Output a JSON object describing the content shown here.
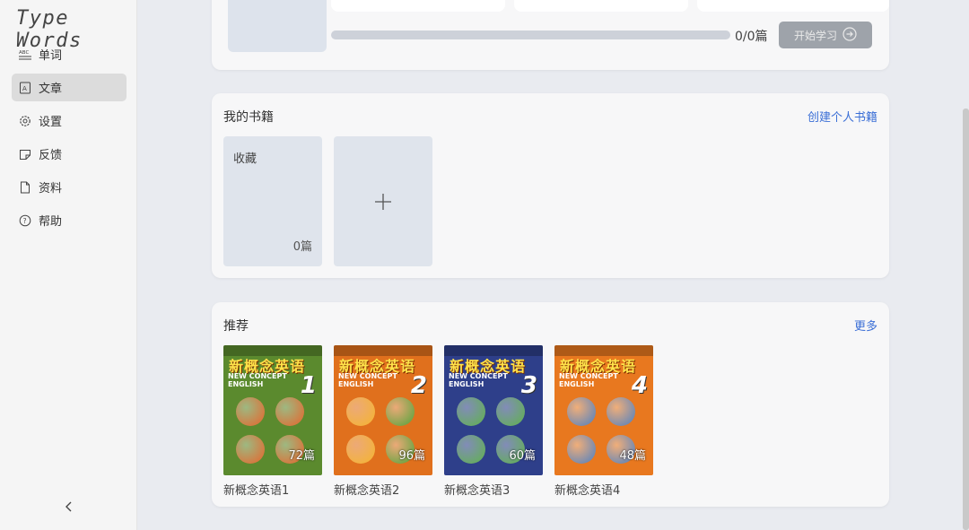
{
  "app": {
    "logo": "Type Words"
  },
  "sidebar": {
    "items": [
      {
        "label": "单词",
        "icon": "abc-icon",
        "active": false
      },
      {
        "label": "文章",
        "icon": "article-icon",
        "active": true
      },
      {
        "label": "设置",
        "icon": "gear-icon",
        "active": false
      },
      {
        "label": "反馈",
        "icon": "feedback-icon",
        "active": false
      },
      {
        "label": "资料",
        "icon": "file-icon",
        "active": false
      },
      {
        "label": "帮助",
        "icon": "help-icon",
        "active": false
      }
    ],
    "collapse_icon": "chevron-left-icon"
  },
  "current": {
    "progress_text": "0/0篇",
    "progress": 0,
    "start_button": "开始学习"
  },
  "my_books": {
    "title": "我的书籍",
    "create_link": "创建个人书籍",
    "favorites": {
      "title": "收藏",
      "count": "0篇"
    },
    "add_icon": "plus-icon"
  },
  "recommend": {
    "title": "推荐",
    "more_link": "更多",
    "books": [
      {
        "name": "新概念英语1",
        "count": "72篇",
        "num": "1",
        "cover_text": "新概念英语",
        "cover_en": "NEW CONCEPT ENGLISH",
        "color": "#5b8a2e"
      },
      {
        "name": "新概念英语2",
        "count": "96篇",
        "num": "2",
        "cover_text": "新概念英语",
        "cover_en": "NEW CONCEPT ENGLISH",
        "color": "#e0701d"
      },
      {
        "name": "新概念英语3",
        "count": "60篇",
        "num": "3",
        "cover_text": "新概念英语",
        "cover_en": "NEW CONCEPT ENGLISH",
        "color": "#2e3f8a"
      },
      {
        "name": "新概念英语4",
        "count": "48篇",
        "num": "4",
        "cover_text": "新概念英语",
        "cover_en": "NEW CONCEPT ENGLISH",
        "color": "#e8781f"
      }
    ]
  }
}
